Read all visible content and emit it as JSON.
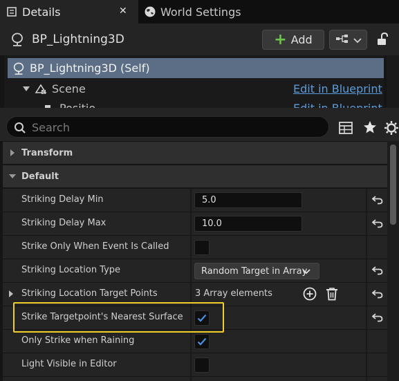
{
  "tabs": [
    {
      "label": "Details",
      "close": "✕"
    },
    {
      "label": "World Settings"
    }
  ],
  "header": {
    "blueprint_name": "BP_Lightning3D",
    "add_label": "Add"
  },
  "tree": {
    "selected": "BP_Lightning3D (Self)",
    "scene_label": "Scene",
    "edit_link": "Edit in Blueprint",
    "partial_label": "Positio",
    "partial_link": "Edit in Blueprint"
  },
  "search": {
    "placeholder": "Search"
  },
  "categories": {
    "transform": "Transform",
    "default": "Default"
  },
  "properties": [
    {
      "label": "Striking Delay Min",
      "value": "5.0"
    },
    {
      "label": "Striking Delay Max",
      "value": "10.0"
    },
    {
      "label": "Strike Only When Event Is Called",
      "checked": false
    },
    {
      "label": "Striking Location Type",
      "value": "Random Target in Array"
    },
    {
      "label": "Striking Location Target Points",
      "value": "3 Array elements"
    },
    {
      "label": "Strike Targetpoint's Nearest Surface",
      "checked": true
    },
    {
      "label": "Only Strike when Raining",
      "checked": true
    },
    {
      "label": "Light Visible in Editor",
      "checked": false
    }
  ],
  "colors": {
    "accent_blue": "#5b9cdc",
    "selection": "#5b6e86",
    "highlight": "#f2cf2a",
    "add_green": "#6dc44a"
  }
}
